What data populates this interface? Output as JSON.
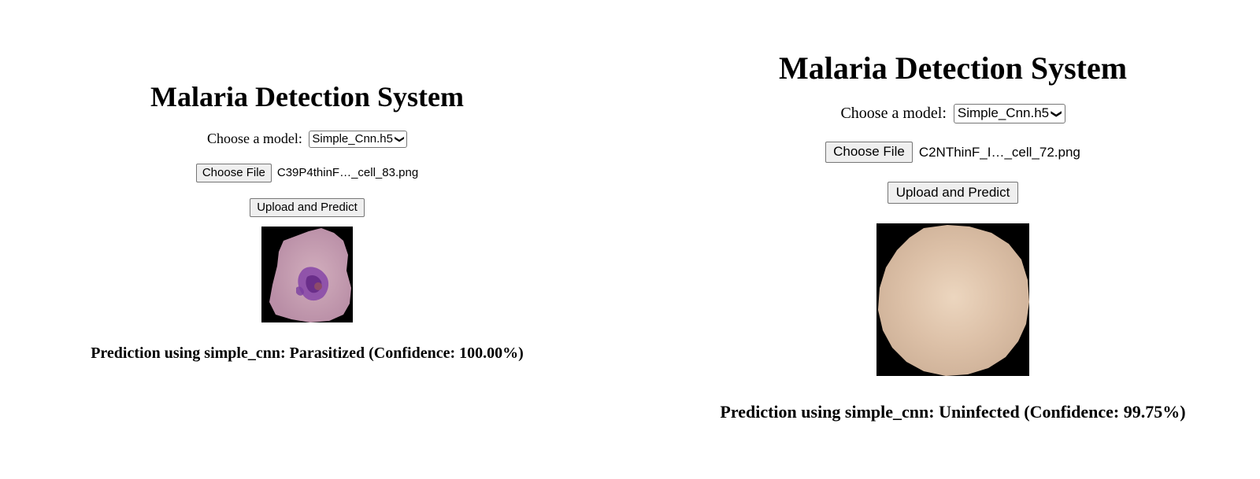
{
  "left": {
    "title": "Malaria Detection System",
    "model_label": "Choose a model:",
    "model_selected": "Simple_Cnn.h5",
    "choose_file_label": "Choose File",
    "file_name": "C39P4thinF…_cell_83.png",
    "upload_label": "Upload and Predict",
    "cell_image": "parasitized-cell-image",
    "result_text": "Prediction using simple_cnn: Parasitized (Confidence: 100.00%)"
  },
  "right": {
    "title": "Malaria Detection System",
    "model_label": "Choose a model:",
    "model_selected": "Simple_Cnn.h5",
    "choose_file_label": "Choose File",
    "file_name": "C2NThinF_I…_cell_72.png",
    "upload_label": "Upload and Predict",
    "cell_image": "uninfected-cell-image",
    "result_text": "Prediction using simple_cnn: Uninfected (Confidence: 99.75%)"
  },
  "colors": {
    "button_bg": "#efefef",
    "border": "#767676",
    "image_bg": "#000000",
    "parasitized_cell": "#c9a2b4",
    "parasite_stain": "#7b3fa0",
    "uninfected_cell": "#dcc0a7"
  },
  "icons": {
    "dropdown": "chevron-down-icon"
  }
}
